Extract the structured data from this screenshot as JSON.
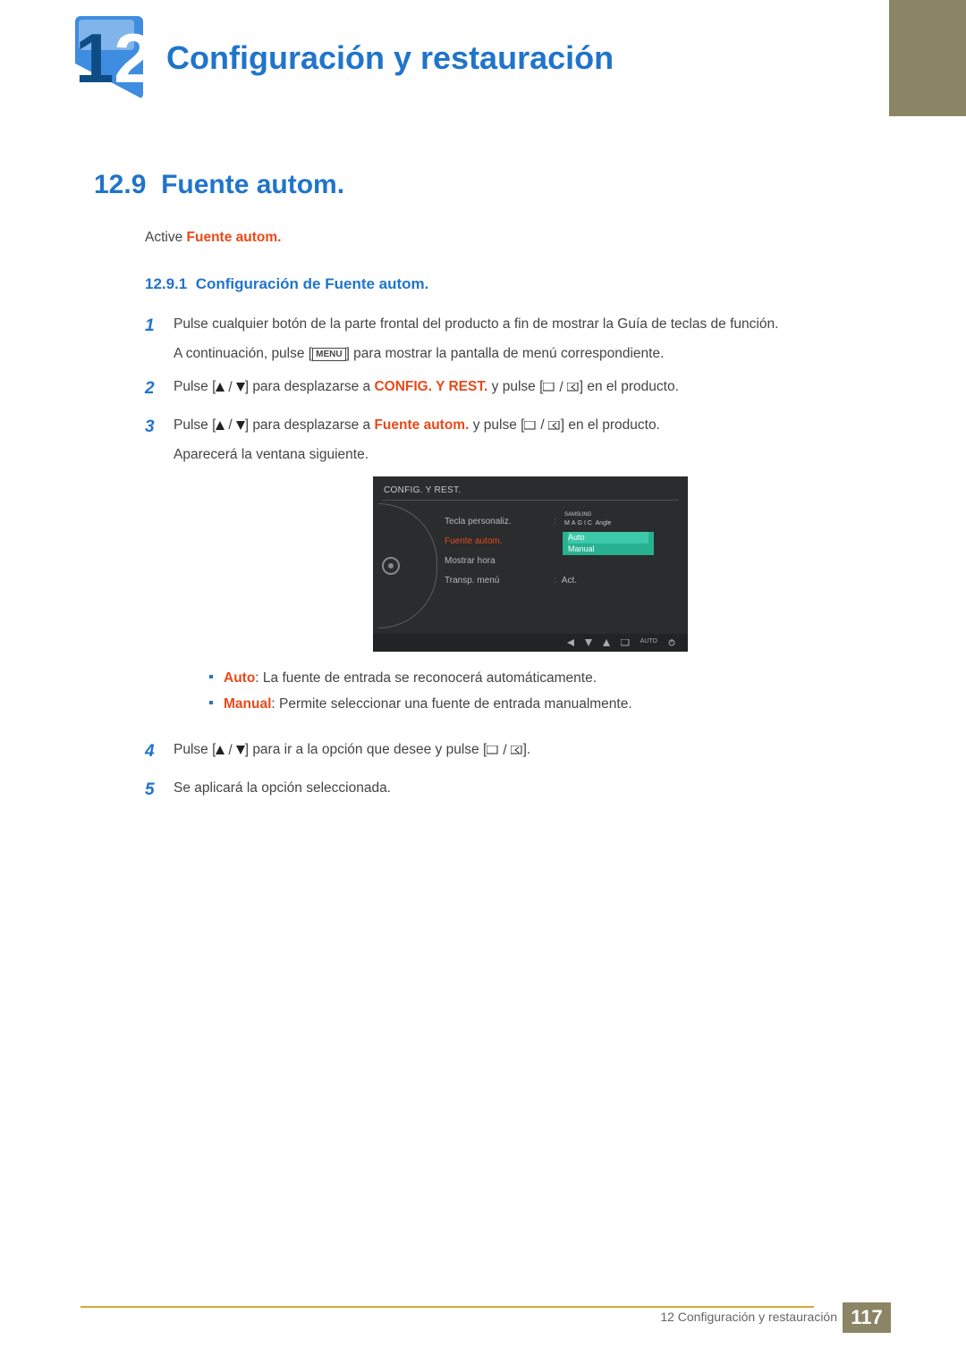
{
  "chapter": {
    "number_a": "1",
    "number_b": "2",
    "title": "Configuración y restauración"
  },
  "section": {
    "number": "12.9",
    "title": "Fuente autom."
  },
  "intro": {
    "prefix": "Active ",
    "highlight": "Fuente autom."
  },
  "subsection": {
    "number": "12.9.1",
    "title": "Configuración de Fuente autom."
  },
  "steps": {
    "s1": {
      "p1a": "Pulse cualquier botón de la parte frontal del producto a fin de mostrar la Guía de teclas de función.",
      "p2a": "A continuación, pulse [",
      "menu": "MENU",
      "p2b": "] para mostrar la pantalla de menú correspondiente."
    },
    "s2": {
      "a": "Pulse [",
      "b": "] para desplazarse a ",
      "target": "CONFIG. Y REST.",
      "c": " y pulse [",
      "d": "] en el producto."
    },
    "s3": {
      "a": "Pulse [",
      "b": "] para desplazarse a ",
      "target": "Fuente autom.",
      "c": " y pulse [",
      "d": "] en el producto.",
      "e": "Aparecerá la ventana siguiente."
    },
    "s4": {
      "a": "Pulse [",
      "b": "] para ir a la opción que desee y pulse [",
      "c": "]."
    },
    "s5": "Se aplicará la opción seleccionada."
  },
  "osd": {
    "title": "CONFIG. Y REST.",
    "items": [
      "Tecla personaliz.",
      "Fuente autom.",
      "Mostrar hora",
      "Transp. menú"
    ],
    "val1_brand": "SAMSUNG",
    "val1_magic": "MAGIC",
    "val1_angle": "Angle",
    "opt_auto": "Auto",
    "opt_manual": "Manual",
    "val4": "Act.",
    "strip_auto": "AUTO"
  },
  "bullets": {
    "auto_label": "Auto",
    "auto_text": ": La fuente de entrada se reconocerá automáticamente.",
    "manual_label": "Manual",
    "manual_text": ": Permite seleccionar una fuente de entrada manualmente."
  },
  "footer": {
    "chapter_line": "12 Configuración y restauración",
    "page": "117"
  }
}
